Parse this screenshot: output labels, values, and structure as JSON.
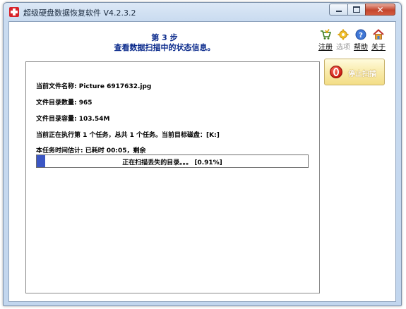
{
  "window": {
    "title": "超级硬盘数据恢复软件 V4.2.3.2"
  },
  "header": {
    "step": "第 3 步",
    "subtitle": "查看数据扫描中的状态信息。"
  },
  "toolbar": {
    "register_label": "注册",
    "options_label": "选项",
    "help_label": "帮助",
    "about_label": "关于"
  },
  "scan": {
    "current_file": "当前文件名称:  Picture 6917632.jpg",
    "dir_count": "文件目录数量:  965",
    "dir_size": "文件目录容量:  103.54M",
    "task": "当前正在执行第 1 个任务，总共 1 个任务。当前目标磁盘：[K:]",
    "time": "本任务时间估计:  已耗时 00:05，剩余",
    "progress_text": "正在扫描丢失的目录。。。 [0.91%]",
    "progress_fraction": 0.0091
  },
  "buttons": {
    "stop_label": "停止扫描"
  },
  "colors": {
    "accent_text": "#0a2a8c",
    "progress_fill": "#3b56c4",
    "stop_button": "#f9ebab"
  }
}
